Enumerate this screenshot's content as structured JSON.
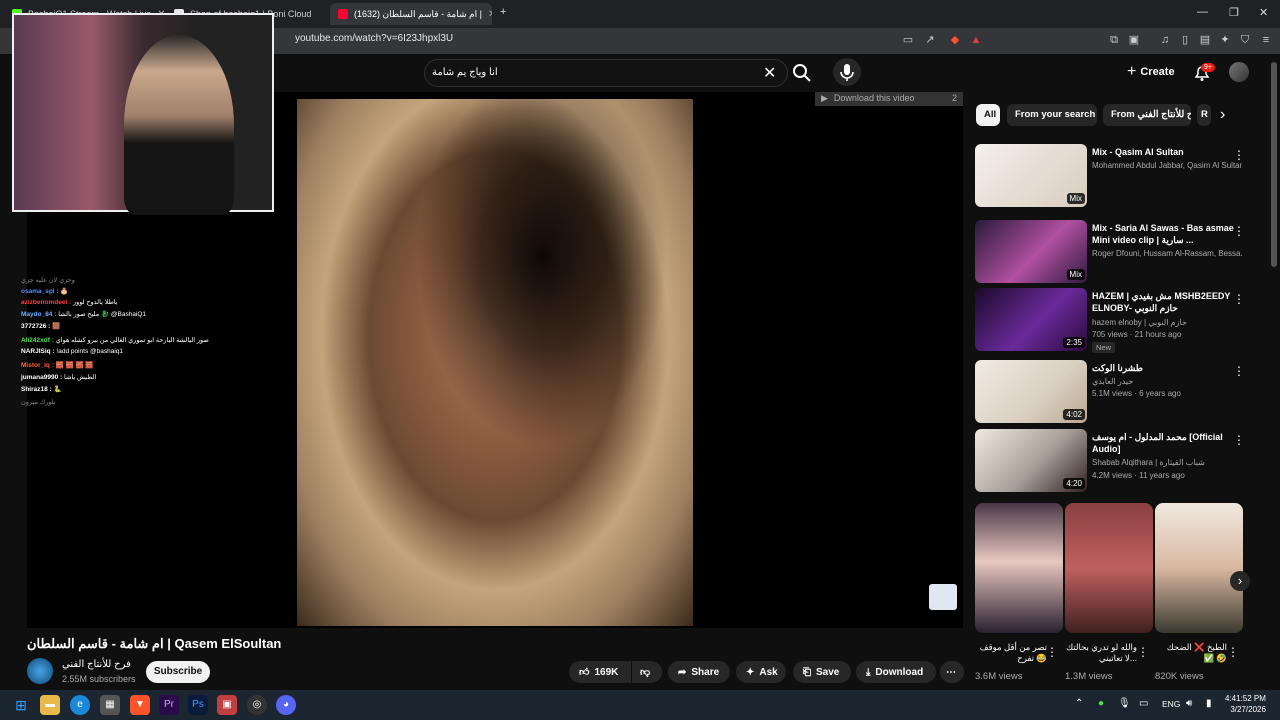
{
  "browser": {
    "tabs": [
      {
        "label": "BashaiQ1 Stream - Watch Live",
        "favicon_color": "#53fc18"
      },
      {
        "label": "Shop of bashaiq1 | Boni Cloud",
        "favicon_color": "#e8e8e8"
      },
      {
        "label": "(1632) ام شامة - قاسم السلطان |",
        "favicon_color": "#ff0033"
      }
    ],
    "url": "youtube.com/watch?v=6I23Jhpxl3U",
    "new_tab": "+",
    "min": "—",
    "max": "❐",
    "close": "✕"
  },
  "youtube": {
    "search_value": "انا وياج يم شامة",
    "create_label": "Create",
    "notif_badge": "9+",
    "download_overlay": "Download this video",
    "download_overlay_num": "2",
    "video_title": "ام شامة - قاسم السلطان | Qasem ElSoultan",
    "channel_name": "فرح للأنتاج الفني",
    "channel_subs": "2.55M subscribers",
    "subscribe_label": "Subscribe",
    "like_count": "169K",
    "share_label": "Share",
    "ask_label": "Ask",
    "save_label": "Save",
    "download_label": "Download"
  },
  "chips": [
    {
      "label": "All"
    },
    {
      "label": "From your search"
    },
    {
      "label": "From فرح للأنتاج الفني"
    },
    {
      "label": "R"
    }
  ],
  "recommendations": [
    {
      "title": "Mix - Qasim Al Sultan",
      "channel": "Mohammed Abdul Jabbar, Qasim Al Sultan, Ahmed Al...",
      "meta": "",
      "badge": "Mix",
      "color": "#e8e4dc"
    },
    {
      "title": "Mix - Saria Al Sawas - Bas asmae Mini video clip | سارية ...",
      "channel": "Roger Dfouni, Hussam Al-Rassam, Bessa...",
      "meta": "",
      "badge": "Mix",
      "color": "#7a3a8a"
    },
    {
      "title": "HAZEM | مش بفيدي MSHB2EEDY ELNOBY- حازم النوبي",
      "channel": "hazem elnoby | حازم النوبي",
      "meta": "705 views · 21 hours ago",
      "badge": "2:35",
      "color": "#4a1a6a",
      "new": "New"
    },
    {
      "title": "طشرنا الوكت",
      "channel": "حيدر العابدي",
      "meta": "5.1M views · 6 years ago",
      "badge": "4:02",
      "color": "#e6ded2"
    },
    {
      "title": "محمد المدلول - ام يوسف [Official Audio]",
      "channel": "Shabab Alqithara | شباب القيثارة",
      "meta": "4.2M views · 11 years ago",
      "badge": "4:20",
      "color": "#c8c0b4"
    }
  ],
  "shorts": [
    {
      "title": "تصر من أقل موقف تفرح 😂",
      "views": "3.6M views",
      "color": "#3a3040"
    },
    {
      "title": "والله لو تدري بحالتك لا تعاتبني...",
      "views": "1.3M views",
      "color": "#6a3030"
    },
    {
      "title": "الطبخ ❌ الضحك ✅ 🤣",
      "views": "820K views",
      "color": "#e8e0d8"
    }
  ],
  "chat": [
    {
      "user": "",
      "msg": "وحزي لان عليه جزي",
      "color": "#888888"
    },
    {
      "user": "osama_spl :",
      "msg": "🎂",
      "color": "#5a8cff"
    },
    {
      "user": "azizbenomdeel :",
      "msg": "باطلا يالدوح لوور",
      "color": "#ff4040"
    },
    {
      "user": "Maydo_84 :",
      "msg": "مليح صور بالشا 🐉 @BashaiQ1",
      "color": "#6ab0ff"
    },
    {
      "user": "3772726 :",
      "msg": "🟫",
      "color": "#ffffff"
    },
    {
      "user": "Ali242xdf :",
      "msg": "صور اليالشة البارحة ابو تموري الغالي من بيرو كشله هواي",
      "color": "#50e050"
    },
    {
      "user": "NARJISiq :",
      "msg": "!add points @bashaiq1",
      "color": "#ffffff"
    },
    {
      "user": "Mistor_iq :",
      "msg": "🧱 🧱 🧱 🧱",
      "color": "#ff6040"
    },
    {
      "user": "jumana9990 :",
      "msg": "الطيش ياشا",
      "color": "#ffffff"
    },
    {
      "user": "Shiraz18 :",
      "msg": "🐍",
      "color": "#ffffff"
    },
    {
      "user": "",
      "msg": "بلورك ميرون",
      "color": "#888888"
    }
  ],
  "taskbar": {
    "lang": "ENG",
    "time": "4:41:52 PM",
    "date": "3/27/2026",
    "apps": [
      "start",
      "explorer",
      "edge",
      "store",
      "brave",
      "premiere",
      "photoshop",
      "app",
      "obs",
      "discord"
    ]
  }
}
